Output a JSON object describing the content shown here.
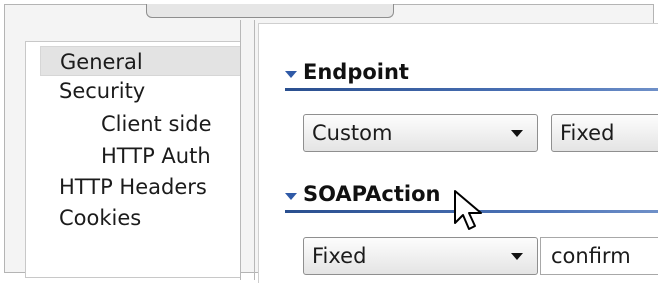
{
  "nav": {
    "items": [
      {
        "label": "General",
        "selected": true
      },
      {
        "label": "Security"
      },
      {
        "label": "Client side"
      },
      {
        "label": "HTTP Auth"
      },
      {
        "label": "HTTP Headers"
      },
      {
        "label": "Cookies"
      }
    ]
  },
  "endpoint": {
    "title": "Endpoint",
    "mode_value": "Custom",
    "type_value": "Fixed"
  },
  "soapaction": {
    "title": "SOAPAction",
    "mode_value": "Fixed",
    "value": "confirm"
  },
  "icons": {
    "collapse": "triangle-down",
    "combo_arrow": "chevron-down",
    "pointer": "mouse-pointer"
  },
  "colors": {
    "accent": "#2f5aa7",
    "selected_bg": "#e3e3e3"
  }
}
